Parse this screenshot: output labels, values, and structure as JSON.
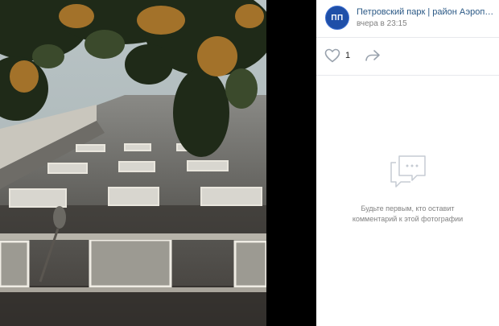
{
  "post": {
    "owner_name": "Петровский парк | район Аэропорт...",
    "owner_avatar_text": "ПП",
    "timestamp": "вчера в 23:15"
  },
  "actions": {
    "like_count": "1",
    "like_icon": "heart-icon",
    "share_icon": "share-icon"
  },
  "comments": {
    "empty_icon": "comment-bubble-icon",
    "empty_text": "Будьте первым, кто оставит комментарий к этой фотографии"
  },
  "colors": {
    "link": "#2a5885",
    "meta": "#828282",
    "avatar_bg": "#1f4fa8",
    "divider": "#e7e8ec"
  }
}
